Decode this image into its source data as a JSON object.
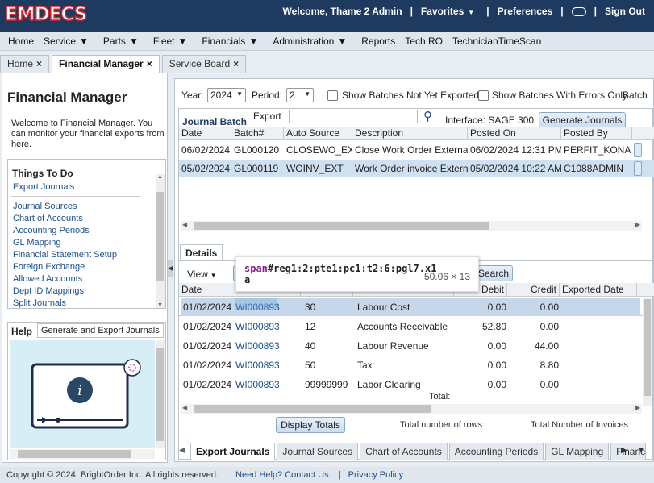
{
  "header": {
    "logo": "EMDECS",
    "welcome": "Welcome, Thame 2 Admin",
    "favorites": "Favorites",
    "preferences": "Preferences",
    "signout": "Sign Out"
  },
  "menu": [
    "Home",
    "Service",
    "Parts",
    "Fleet",
    "Financials",
    "Administration",
    "Reports",
    "Tech RO",
    "TechnicianTimeScan"
  ],
  "tabs": [
    {
      "label": "Home"
    },
    {
      "label": "Financial Manager"
    },
    {
      "label": "Service Board"
    }
  ],
  "left": {
    "title": "Financial Manager",
    "welcome": "Welcome to Financial Manager. You can monitor your financial exports from here.",
    "things_title": "Things To Do",
    "things": [
      "Export Journals",
      "Journal Sources",
      "Chart of Accounts",
      "Accounting Periods",
      "GL Mapping",
      "Financial Statement Setup",
      "Foreign Exchange",
      "Allowed Accounts",
      "Dept ID Mappings",
      "Split Journals"
    ],
    "help_title": "Help",
    "help_tab": "Generate and Export Journals"
  },
  "filters": {
    "year_label": "Year:",
    "year": "2024",
    "period_label": "Period:",
    "period": "2",
    "not_exported": "Show Batches Not Yet Exported",
    "with_errors": "Show Batches With Errors Only",
    "batch": "Batch",
    "export_location_label": "Export Location:",
    "interface": "Interface:  SAGE  300",
    "generate": "Generate Journals"
  },
  "batches": {
    "title": "Journal Batch",
    "columns": [
      "Date",
      "Batch#",
      "Auto Source",
      "Description",
      "Posted On",
      "Posted By"
    ],
    "rows": [
      [
        "06/02/2024",
        "GL000120",
        "CLOSEWO_EXT",
        "Close Work Order External",
        "06/02/2024 12:31 PM",
        "PERFIT_KONA"
      ],
      [
        "05/02/2024",
        "GL000119",
        "WOINV_EXT",
        "Work Order invoice External",
        "05/02/2024 10:22 AM",
        "C1088ADMIN"
      ]
    ]
  },
  "details": {
    "tab": "Details",
    "view": "View",
    "search": "Search",
    "columns": [
      "Date",
      "",
      "",
      "",
      "Debit",
      "Credit",
      "Exported Date"
    ],
    "rows": [
      [
        "01/02/2024",
        "WI000893",
        "30",
        "Labour Cost",
        "0.00",
        "0.00"
      ],
      [
        "01/02/2024",
        "WI000893",
        "12",
        "Accounts Receivable",
        "52.80",
        "0.00"
      ],
      [
        "01/02/2024",
        "WI000893",
        "40",
        "Labour Revenue",
        "0.00",
        "44.00"
      ],
      [
        "01/02/2024",
        "WI000893",
        "50",
        "Tax",
        "0.00",
        "8.80"
      ],
      [
        "01/02/2024",
        "WI000893",
        "99999999",
        "Labor Clearing",
        "0.00",
        "0.00"
      ]
    ],
    "total_label": "Total:",
    "display_totals": "Display Totals",
    "total_rows": "Total number of rows:",
    "total_invoices": "Total Number of Invoices:"
  },
  "tooltip": {
    "selector_tag": "span",
    "selector_rest": "#reg1:2:pte1:pc1:t2:6:pgl7.x1",
    "selector_tail": "a",
    "size": "50.06 × 13"
  },
  "bottom_tabs": [
    "Export Journals",
    "Journal Sources",
    "Chart of Accounts",
    "Accounting Periods",
    "GL Mapping",
    "Financia"
  ],
  "footer": {
    "copyright": "Copyright © 2024, BrightOrder Inc. All rights reserved.",
    "help": "Need Help? Contact Us.",
    "privacy": "Privacy Policy"
  }
}
